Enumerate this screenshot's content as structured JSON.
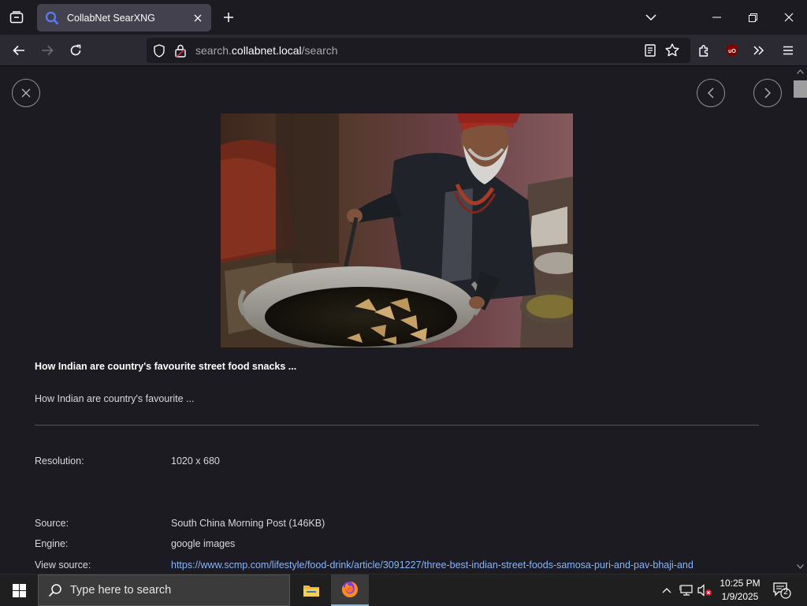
{
  "browser": {
    "tab_title": "CollabNet SearXNG",
    "url_prefix": "search.",
    "url_host": "collabnet.local",
    "url_path": "/search"
  },
  "result": {
    "title": "How Indian are country's favourite street food snacks ...",
    "snippet": "How Indian are country's favourite ...",
    "resolution_label": "Resolution:",
    "resolution_value": "1020 x 680",
    "source_label": "Source:",
    "source_value": "South China Morning Post (146KB)",
    "engine_label": "Engine:",
    "engine_value": "google images",
    "view_source_label": "View source:",
    "view_source_value": "https://www.scmp.com/lifestyle/food-drink/article/3091227/three-best-indian-street-foods-samosa-puri-and-pav-bhaji-and"
  },
  "taskbar": {
    "search_placeholder": "Type here to search",
    "time": "10:25 PM",
    "date": "1/9/2025",
    "notification_count": "2"
  },
  "colors": {
    "accent": "#76b9ed",
    "link": "#8ab4f8",
    "background": "#1c1b22"
  }
}
